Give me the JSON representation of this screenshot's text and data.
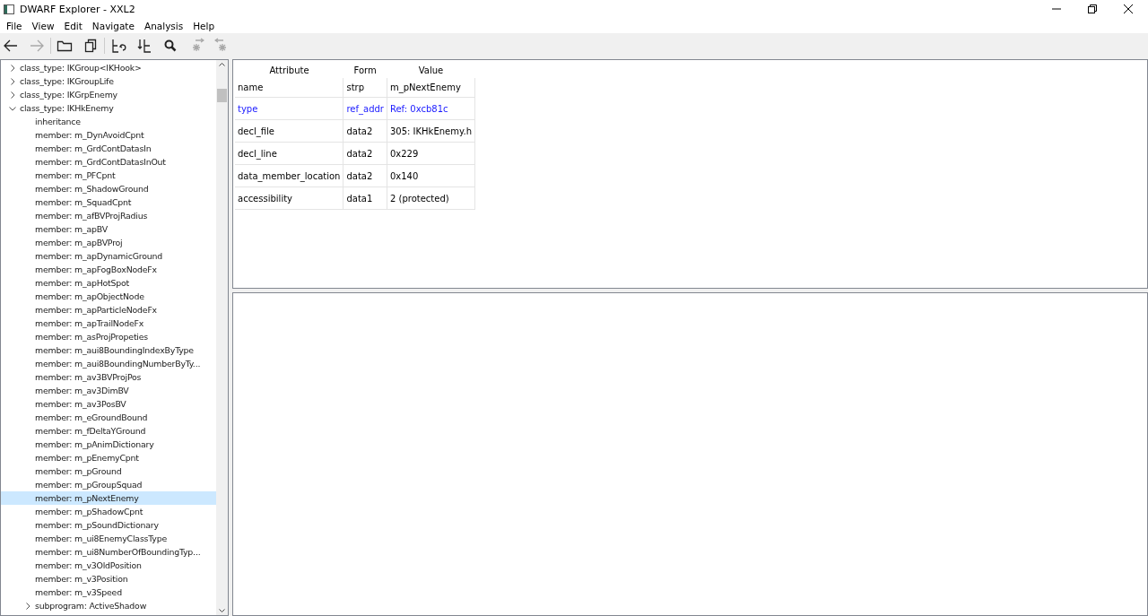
{
  "window": {
    "title": "DWARF Explorer - XXL2"
  },
  "menu": [
    "File",
    "View",
    "Edit",
    "Navigate",
    "Analysis",
    "Help"
  ],
  "toolbar": [
    {
      "kind": "back",
      "disabled": false
    },
    {
      "kind": "forward",
      "disabled": true
    },
    {
      "kind": "open",
      "disabled": false
    },
    {
      "kind": "copy",
      "disabled": false
    },
    {
      "kind": "parent",
      "disabled": false
    },
    {
      "kind": "child",
      "disabled": false
    },
    {
      "kind": "search",
      "disabled": false
    },
    {
      "kind": "findnext",
      "disabled": true
    },
    {
      "kind": "findprev",
      "disabled": true
    }
  ],
  "tree": [
    {
      "label": "class_type: IKGroup<IKHook>",
      "expanded": false,
      "selected": false
    },
    {
      "label": "class_type: IKGroupLife",
      "expanded": false,
      "selected": false
    },
    {
      "label": "class_type: IKGrpEnemy",
      "expanded": false,
      "selected": false
    },
    {
      "label": "class_type: IKHkEnemy",
      "expanded": true,
      "selected": false,
      "children": [
        {
          "label": "inheritance",
          "selected": false
        },
        {
          "label": "member: m_DynAvoidCpnt",
          "selected": false
        },
        {
          "label": "member: m_GrdContDatasIn",
          "selected": false
        },
        {
          "label": "member: m_GrdContDatasInOut",
          "selected": false
        },
        {
          "label": "member: m_PFCpnt",
          "selected": false
        },
        {
          "label": "member: m_ShadowGround",
          "selected": false
        },
        {
          "label": "member: m_SquadCpnt",
          "selected": false
        },
        {
          "label": "member: m_afBVProjRadius",
          "selected": false
        },
        {
          "label": "member: m_apBV",
          "selected": false
        },
        {
          "label": "member: m_apBVProj",
          "selected": false
        },
        {
          "label": "member: m_apDynamicGround",
          "selected": false
        },
        {
          "label": "member: m_apFogBoxNodeFx",
          "selected": false
        },
        {
          "label": "member: m_apHotSpot",
          "selected": false
        },
        {
          "label": "member: m_apObjectNode",
          "selected": false
        },
        {
          "label": "member: m_apParticleNodeFx",
          "selected": false
        },
        {
          "label": "member: m_apTrailNodeFx",
          "selected": false
        },
        {
          "label": "member: m_asProjPropeties",
          "selected": false
        },
        {
          "label": "member: m_aui8BoundingIndexByType",
          "selected": false
        },
        {
          "label": "member: m_aui8BoundingNumberByTy...",
          "selected": false
        },
        {
          "label": "member: m_av3BVProjPos",
          "selected": false
        },
        {
          "label": "member: m_av3DimBV",
          "selected": false
        },
        {
          "label": "member: m_av3PosBV",
          "selected": false
        },
        {
          "label": "member: m_eGroundBound",
          "selected": false
        },
        {
          "label": "member: m_fDeltaYGround",
          "selected": false
        },
        {
          "label": "member: m_pAnimDictionary",
          "selected": false
        },
        {
          "label": "member: m_pEnemyCpnt",
          "selected": false
        },
        {
          "label": "member: m_pGround",
          "selected": false
        },
        {
          "label": "member: m_pGroupSquad",
          "selected": false
        },
        {
          "label": "member: m_pNextEnemy",
          "selected": true
        },
        {
          "label": "member: m_pShadowCpnt",
          "selected": false
        },
        {
          "label": "member: m_pSoundDictionary",
          "selected": false
        },
        {
          "label": "member: m_ui8EnemyClassType",
          "selected": false
        },
        {
          "label": "member: m_ui8NumberOfBoundingTyp...",
          "selected": false
        },
        {
          "label": "member: m_v3OldPosition",
          "selected": false
        },
        {
          "label": "member: m_v3Position",
          "selected": false
        },
        {
          "label": "member: m_v3Speed",
          "selected": false
        },
        {
          "label": "subprogram: ActiveShadow",
          "expanded": false,
          "selected": false
        }
      ]
    }
  ],
  "attributes": {
    "columns": [
      "Attribute",
      "Form",
      "Value"
    ],
    "rows": [
      {
        "attribute": "name",
        "form": "strp",
        "value": "m_pNextEnemy",
        "link": false
      },
      {
        "attribute": "type",
        "form": "ref_addr",
        "value": "Ref: 0xcb81c",
        "link": true
      },
      {
        "attribute": "decl_file",
        "form": "data2",
        "value": "305: IKHkEnemy.h",
        "link": false
      },
      {
        "attribute": "decl_line",
        "form": "data2",
        "value": "0x229",
        "link": false
      },
      {
        "attribute": "data_member_location",
        "form": "data2",
        "value": "0x140",
        "link": false
      },
      {
        "attribute": "accessibility",
        "form": "data1",
        "value": "2 (protected)",
        "link": false
      }
    ]
  }
}
